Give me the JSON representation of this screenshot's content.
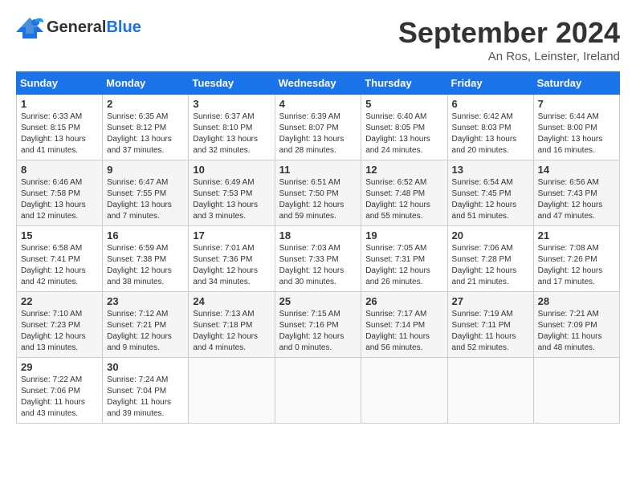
{
  "logo": {
    "general": "General",
    "blue": "Blue"
  },
  "title": "September 2024",
  "location": "An Ros, Leinster, Ireland",
  "weekdays": [
    "Sunday",
    "Monday",
    "Tuesday",
    "Wednesday",
    "Thursday",
    "Friday",
    "Saturday"
  ],
  "weeks": [
    [
      {
        "day": 1,
        "info": "Sunrise: 6:33 AM\nSunset: 8:15 PM\nDaylight: 13 hours\nand 41 minutes."
      },
      {
        "day": 2,
        "info": "Sunrise: 6:35 AM\nSunset: 8:12 PM\nDaylight: 13 hours\nand 37 minutes."
      },
      {
        "day": 3,
        "info": "Sunrise: 6:37 AM\nSunset: 8:10 PM\nDaylight: 13 hours\nand 32 minutes."
      },
      {
        "day": 4,
        "info": "Sunrise: 6:39 AM\nSunset: 8:07 PM\nDaylight: 13 hours\nand 28 minutes."
      },
      {
        "day": 5,
        "info": "Sunrise: 6:40 AM\nSunset: 8:05 PM\nDaylight: 13 hours\nand 24 minutes."
      },
      {
        "day": 6,
        "info": "Sunrise: 6:42 AM\nSunset: 8:03 PM\nDaylight: 13 hours\nand 20 minutes."
      },
      {
        "day": 7,
        "info": "Sunrise: 6:44 AM\nSunset: 8:00 PM\nDaylight: 13 hours\nand 16 minutes."
      }
    ],
    [
      {
        "day": 8,
        "info": "Sunrise: 6:46 AM\nSunset: 7:58 PM\nDaylight: 13 hours\nand 12 minutes."
      },
      {
        "day": 9,
        "info": "Sunrise: 6:47 AM\nSunset: 7:55 PM\nDaylight: 13 hours\nand 7 minutes."
      },
      {
        "day": 10,
        "info": "Sunrise: 6:49 AM\nSunset: 7:53 PM\nDaylight: 13 hours\nand 3 minutes."
      },
      {
        "day": 11,
        "info": "Sunrise: 6:51 AM\nSunset: 7:50 PM\nDaylight: 12 hours\nand 59 minutes."
      },
      {
        "day": 12,
        "info": "Sunrise: 6:52 AM\nSunset: 7:48 PM\nDaylight: 12 hours\nand 55 minutes."
      },
      {
        "day": 13,
        "info": "Sunrise: 6:54 AM\nSunset: 7:45 PM\nDaylight: 12 hours\nand 51 minutes."
      },
      {
        "day": 14,
        "info": "Sunrise: 6:56 AM\nSunset: 7:43 PM\nDaylight: 12 hours\nand 47 minutes."
      }
    ],
    [
      {
        "day": 15,
        "info": "Sunrise: 6:58 AM\nSunset: 7:41 PM\nDaylight: 12 hours\nand 42 minutes."
      },
      {
        "day": 16,
        "info": "Sunrise: 6:59 AM\nSunset: 7:38 PM\nDaylight: 12 hours\nand 38 minutes."
      },
      {
        "day": 17,
        "info": "Sunrise: 7:01 AM\nSunset: 7:36 PM\nDaylight: 12 hours\nand 34 minutes."
      },
      {
        "day": 18,
        "info": "Sunrise: 7:03 AM\nSunset: 7:33 PM\nDaylight: 12 hours\nand 30 minutes."
      },
      {
        "day": 19,
        "info": "Sunrise: 7:05 AM\nSunset: 7:31 PM\nDaylight: 12 hours\nand 26 minutes."
      },
      {
        "day": 20,
        "info": "Sunrise: 7:06 AM\nSunset: 7:28 PM\nDaylight: 12 hours\nand 21 minutes."
      },
      {
        "day": 21,
        "info": "Sunrise: 7:08 AM\nSunset: 7:26 PM\nDaylight: 12 hours\nand 17 minutes."
      }
    ],
    [
      {
        "day": 22,
        "info": "Sunrise: 7:10 AM\nSunset: 7:23 PM\nDaylight: 12 hours\nand 13 minutes."
      },
      {
        "day": 23,
        "info": "Sunrise: 7:12 AM\nSunset: 7:21 PM\nDaylight: 12 hours\nand 9 minutes."
      },
      {
        "day": 24,
        "info": "Sunrise: 7:13 AM\nSunset: 7:18 PM\nDaylight: 12 hours\nand 4 minutes."
      },
      {
        "day": 25,
        "info": "Sunrise: 7:15 AM\nSunset: 7:16 PM\nDaylight: 12 hours\nand 0 minutes."
      },
      {
        "day": 26,
        "info": "Sunrise: 7:17 AM\nSunset: 7:14 PM\nDaylight: 11 hours\nand 56 minutes."
      },
      {
        "day": 27,
        "info": "Sunrise: 7:19 AM\nSunset: 7:11 PM\nDaylight: 11 hours\nand 52 minutes."
      },
      {
        "day": 28,
        "info": "Sunrise: 7:21 AM\nSunset: 7:09 PM\nDaylight: 11 hours\nand 48 minutes."
      }
    ],
    [
      {
        "day": 29,
        "info": "Sunrise: 7:22 AM\nSunset: 7:06 PM\nDaylight: 11 hours\nand 43 minutes."
      },
      {
        "day": 30,
        "info": "Sunrise: 7:24 AM\nSunset: 7:04 PM\nDaylight: 11 hours\nand 39 minutes."
      },
      null,
      null,
      null,
      null,
      null
    ]
  ]
}
